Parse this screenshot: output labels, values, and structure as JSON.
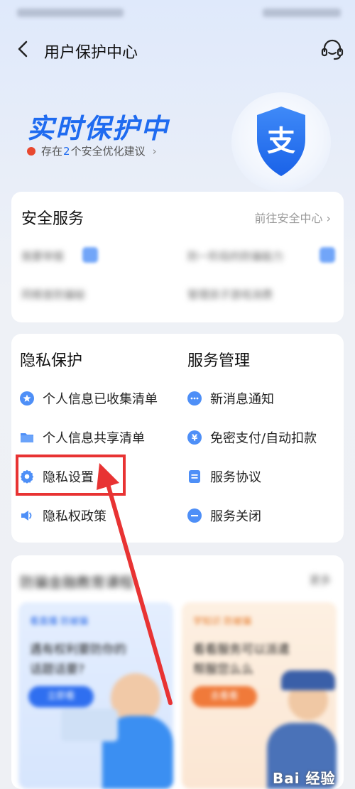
{
  "nav": {
    "title": "用户保护中心"
  },
  "hero": {
    "title": "实时保护中",
    "subtitle_pre": "存在",
    "subtitle_count": "2",
    "subtitle_post": "个安全优化建议",
    "logo_glyph": "支",
    "colors": {
      "accent": "#1f6bf0",
      "dot": "#e8482f"
    }
  },
  "security_service": {
    "title": "安全服务",
    "link": "前往安全中心",
    "blurred_items": [
      "我要举报",
      "防一阶段的防骗能力",
      "同根查防骗秘",
      "管理孩子游戏消费"
    ]
  },
  "privacy": {
    "title": "隐私保护",
    "items": [
      {
        "label": "个人信息已收集清单",
        "icon": "star-circle-icon"
      },
      {
        "label": "个人信息共享清单",
        "icon": "folder-icon"
      },
      {
        "label": "隐私设置",
        "icon": "gear-icon"
      },
      {
        "label": "隐私权政策",
        "icon": "speaker-icon"
      }
    ]
  },
  "service_mgmt": {
    "title": "服务管理",
    "items": [
      {
        "label": "新消息通知",
        "icon": "chat-bubble-icon"
      },
      {
        "label": "免密支付/自动扣款",
        "icon": "yen-circle-icon"
      },
      {
        "label": "服务协议",
        "icon": "document-icon"
      },
      {
        "label": "服务关闭",
        "icon": "minus-circle-icon"
      }
    ]
  },
  "promo": {
    "title": "防骗金融教育课程",
    "link": "更多",
    "left": {
      "tag": "看直播 防被骗",
      "text1": "遇有权利要防你的",
      "text2": "话题话要?",
      "btn": "立即看"
    },
    "right": {
      "tag": "学知识 防被骗",
      "text1": "看看服务可以派遣",
      "text2": "帮服您么么",
      "btn": "去看看"
    }
  },
  "watermark": "Bai 经验"
}
